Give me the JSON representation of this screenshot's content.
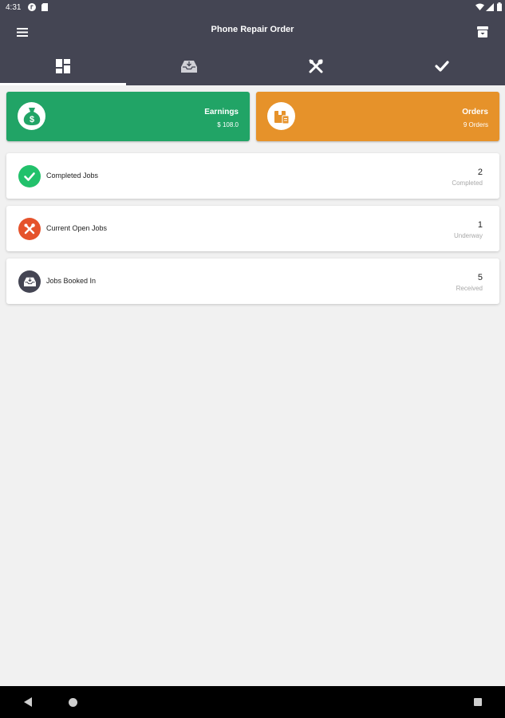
{
  "status_bar": {
    "time": "4:31"
  },
  "app_bar": {
    "title": "Phone Repair Order"
  },
  "tabs": [
    {
      "icon": "dashboard-icon",
      "active": true
    },
    {
      "icon": "inbox-tray-icon",
      "active": false
    },
    {
      "icon": "tools-icon",
      "active": false
    },
    {
      "icon": "checkmark-icon",
      "active": false
    }
  ],
  "summary_cards": {
    "earnings": {
      "label": "Earnings",
      "value": "$ 108.0",
      "color": "#21a466",
      "icon": "money-bag-icon"
    },
    "orders": {
      "label": "Orders",
      "value": "9 Orders",
      "color": "#e6922a",
      "icon": "box-icon"
    }
  },
  "job_rows": [
    {
      "label": "Completed Jobs",
      "count": "2",
      "status": "Completed",
      "icon": "checkmark-icon",
      "color": "#22c16b"
    },
    {
      "label": "Current Open Jobs",
      "count": "1",
      "status": "Underway",
      "icon": "tools-icon",
      "color": "#e5532c"
    },
    {
      "label": "Jobs Booked In",
      "count": "5",
      "status": "Received",
      "icon": "inbox-tray-icon",
      "color": "#444553"
    }
  ],
  "colors": {
    "app_bar": "#444553",
    "background": "#f1f1f1"
  }
}
